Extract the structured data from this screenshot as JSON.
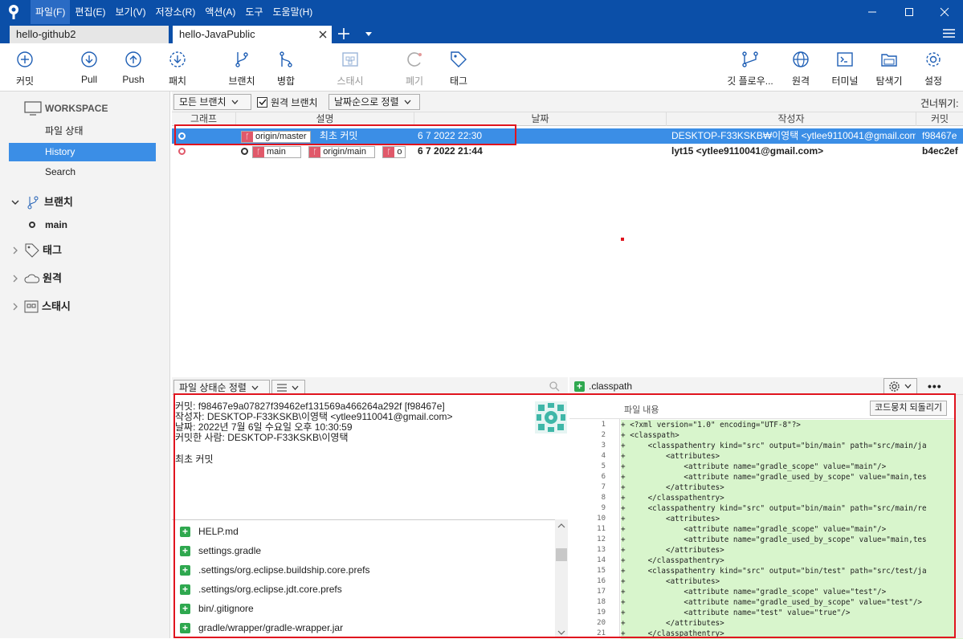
{
  "menus": [
    "파일(F)",
    "편집(E)",
    "보기(V)",
    "저장소(R)",
    "액션(A)",
    "도구",
    "도움말(H)"
  ],
  "tabs": [
    {
      "label": "hello-github2"
    },
    {
      "label": "hello-JavaPublic"
    }
  ],
  "toolbar": {
    "commit": "커밋",
    "pull": "Pull",
    "push": "Push",
    "fetch": "패치",
    "branch": "브랜치",
    "merge": "병합",
    "stash": "스태시",
    "discard": "폐기",
    "tag": "태그",
    "gitflow": "깃 플로우...",
    "remote": "원격",
    "terminal": "터미널",
    "explorer": "탐색기",
    "settings": "설정"
  },
  "sidebar": {
    "workspace": "WORKSPACE",
    "items": [
      "파일 상태",
      "History",
      "Search"
    ],
    "branches": "브랜치",
    "branch_main": "main",
    "tags": "태그",
    "remotes": "원격",
    "stashes": "스태시"
  },
  "filter": {
    "all_branches": "모든 브랜치",
    "remote_branches": "원격 브랜치",
    "sort": "날짜순으로 정렬",
    "jump": "건너뛰기:"
  },
  "columns": {
    "graph": "그래프",
    "desc": "설명",
    "date": "날짜",
    "author": "작성자",
    "commit": "커밋"
  },
  "commits": [
    {
      "refs": [
        "origin/master"
      ],
      "message": "최초 커밋",
      "date": "6 7 2022 22:30",
      "author": "DESKTOP-F33KSKB₩이영택 <ytlee9110041@gmail.com>",
      "hash": "f98467e"
    },
    {
      "refs": [
        "main",
        "origin/main",
        "o"
      ],
      "message": "",
      "date": "6 7 2022 21:44",
      "author": "lyt15 <ytlee9110041@gmail.com>",
      "hash": "b4ec2ef"
    }
  ],
  "lower": {
    "sort_label": "파일 상태순 정렬",
    "file_name": ".classpath",
    "file_content": "파일 내용",
    "revert_hunk": "코드뭉치 되돌리기"
  },
  "commit_info": {
    "commit_label": "커밋:",
    "commit_value": "f98467e9a07827f39462ef131569a466264a292f [f98467e]",
    "author_label": "작성자:",
    "author_value": "DESKTOP-F33KSKB\\이영택 <ytlee9110041@gmail.com>",
    "date_label": "날짜:",
    "date_value": "2022년 7월 6일 수요일 오후 10:30:59",
    "committer_label": "커밋한 사람:",
    "committer_value": "DESKTOP-F33KSKB\\이영택",
    "message": "최초 커밋"
  },
  "files": [
    "HELP.md",
    "settings.gradle",
    ".settings/org.eclipse.buildship.core.prefs",
    ".settings/org.eclipse.jdt.core.prefs",
    "bin/.gitignore",
    "gradle/wrapper/gradle-wrapper.jar"
  ],
  "diff_lines": [
    "+ <?xml version=\"1.0\" encoding=\"UTF-8\"?>",
    "+ <classpath>",
    "+     <classpathentry kind=\"src\" output=\"bin/main\" path=\"src/main/ja",
    "+         <attributes>",
    "+             <attribute name=\"gradle_scope\" value=\"main\"/>",
    "+             <attribute name=\"gradle_used_by_scope\" value=\"main,tes",
    "+         </attributes>",
    "+     </classpathentry>",
    "+     <classpathentry kind=\"src\" output=\"bin/main\" path=\"src/main/re",
    "+         <attributes>",
    "+             <attribute name=\"gradle_scope\" value=\"main\"/>",
    "+             <attribute name=\"gradle_used_by_scope\" value=\"main,tes",
    "+         </attributes>",
    "+     </classpathentry>",
    "+     <classpathentry kind=\"src\" output=\"bin/test\" path=\"src/test/ja",
    "+         <attributes>",
    "+             <attribute name=\"gradle_scope\" value=\"test\"/>",
    "+             <attribute name=\"gradle_used_by_scope\" value=\"test\"/>",
    "+             <attribute name=\"test\" value=\"true\"/>",
    "+         </attributes>",
    "+     </classpathentry>"
  ],
  "colors": {
    "titlebar": "#0b4fa8",
    "selected_row": "#3b8ee6",
    "sidebar_selected": "#3b8ee6",
    "highlight_border": "#e0141e",
    "diff_added": "#d8f5cc"
  }
}
